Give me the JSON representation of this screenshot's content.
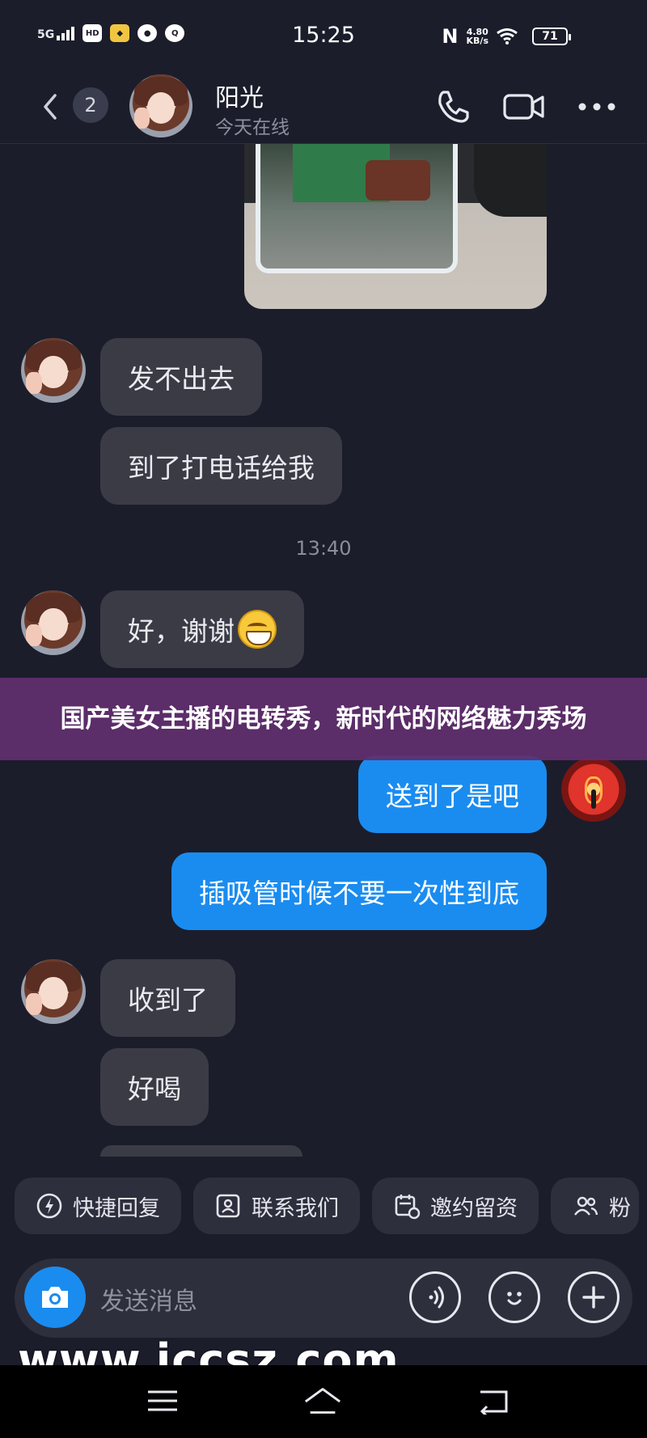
{
  "status_bar": {
    "network": "5G",
    "time": "15:25",
    "speed_value": "4.80",
    "speed_unit": "KB/s",
    "battery": "71"
  },
  "header": {
    "unread_count": "2",
    "contact_name": "阳光",
    "contact_status": "今天在线"
  },
  "messages": [
    {
      "side": "in",
      "text": "发不出去"
    },
    {
      "side": "in",
      "text": "到了打电话给我"
    },
    {
      "side": "time",
      "text": "13:40"
    },
    {
      "side": "in",
      "text": "好，谢谢"
    },
    {
      "side": "out",
      "text": "送到了是吧"
    },
    {
      "side": "out",
      "text": "插吸管时候不要一次性到底"
    },
    {
      "side": "in",
      "text": "收到了"
    },
    {
      "side": "in",
      "text": "好喝"
    }
  ],
  "banner": {
    "title": "国产美女主播的电转秀，新时代的网络魅力秀场"
  },
  "quick_actions": [
    {
      "label": "快捷回复",
      "icon": "lightning-icon"
    },
    {
      "label": "联系我们",
      "icon": "contact-card-icon"
    },
    {
      "label": "邀约留资",
      "icon": "calendar-icon"
    },
    {
      "label": "粉",
      "icon": "group-icon"
    }
  ],
  "input": {
    "placeholder": "发送消息"
  },
  "watermark": "www.iccsz.com",
  "colors": {
    "background": "#1b1d2b",
    "incoming_bubble": "#3a3b45",
    "outgoing_bubble": "#1a8cf0",
    "banner": "#602e6e"
  }
}
